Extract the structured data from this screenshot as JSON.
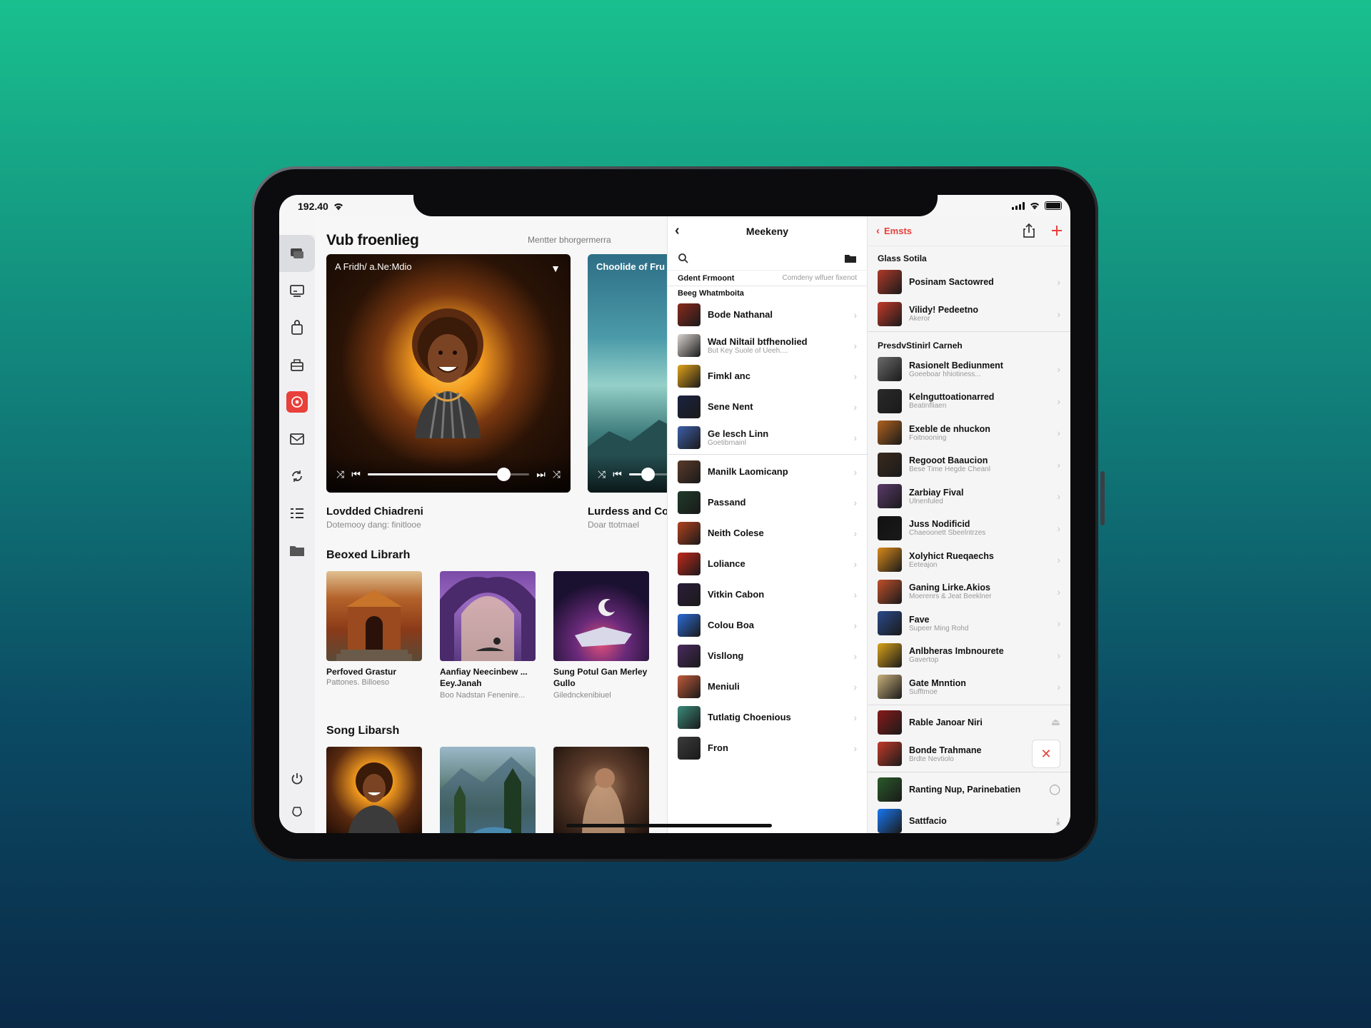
{
  "status": {
    "time": "192.40"
  },
  "main": {
    "title": "Vub froenlieg",
    "subtitle": "Mentter bhorgermerra",
    "player": {
      "header": "A Fridh/ a.Ne:Mdio"
    },
    "player2": {
      "header": "Choolide of Fru"
    },
    "card1": {
      "title": "Lovdded Chiadreni",
      "subtitle": "Dotemooy dang: finitlooe"
    },
    "card2": {
      "title": "Lurdess and Co",
      "subtitle": "Doar ttotmael"
    },
    "section1": {
      "title": "Beoxed Librarh",
      "tiles": [
        {
          "title": "Perfoved Grastur",
          "subtitle": "Pattones. Billoeso"
        },
        {
          "title": "Aanfiay Neecinbew ... Eey.Janah",
          "subtitle": "Boo Nadstan Fenenire..."
        },
        {
          "title": "Sung Potul Gan Merley Gullo",
          "subtitle": "Gilednckenibiuel"
        }
      ]
    },
    "section2": {
      "title": "Song Libarsh"
    }
  },
  "middle": {
    "title": "Meekeny",
    "col_left": "Gdent Frmoont",
    "col_right": "Comdeny wlfuer fixenot",
    "group": "Beeg Whatmboita",
    "items": [
      {
        "title": "Bode Nathanal",
        "subtitle": "",
        "color": "#8a2a1c"
      },
      {
        "title": "Wad Niltail btfhenolied",
        "subtitle": "But Key Suole of Ueeh....",
        "color": "#d9d3cf"
      },
      {
        "title": "Fimkl anc",
        "subtitle": "",
        "color": "#e0a21a"
      },
      {
        "title": "Sene Nent",
        "subtitle": "",
        "color": "#1a2340"
      },
      {
        "title": "Ge lesch Linn",
        "subtitle": "Goetibrnainl",
        "color": "#3d5ea8"
      },
      {
        "title": "Manilk Laomicanp",
        "subtitle": "",
        "color": "#5a3a2a"
      },
      {
        "title": "Passand",
        "subtitle": "",
        "color": "#1f3b2a"
      },
      {
        "title": "Neith Colese",
        "subtitle": "",
        "color": "#b2421e"
      },
      {
        "title": "Loliance",
        "subtitle": "",
        "color": "#c2281c"
      },
      {
        "title": "Vitkin Cabon",
        "subtitle": "",
        "color": "#2c1d3a"
      },
      {
        "title": "Colou Boa",
        "subtitle": "",
        "color": "#2c6bd6"
      },
      {
        "title": "Visllong",
        "subtitle": "",
        "color": "#4a2a5e"
      },
      {
        "title": "Meniuli",
        "subtitle": "",
        "color": "#c05a3a"
      },
      {
        "title": "Tutlatig Choenious",
        "subtitle": "",
        "color": "#3a8a7a"
      },
      {
        "title": "Fron",
        "subtitle": "",
        "color": "#3b3b3b"
      }
    ]
  },
  "right": {
    "back_label": "Emsts",
    "group1": "Glass Sotila",
    "group1_items": [
      {
        "title": "Posinam Sactowred",
        "subtitle": "",
        "color": "#b03a2a"
      },
      {
        "title": "Vilidy! Pedeetno",
        "subtitle": "Akeror",
        "color": "#c23a2a"
      }
    ],
    "group2": "PresdvStinirl Carneh",
    "group2_items": [
      {
        "title": "Rasionelt Bediunment",
        "subtitle": "Goeeboar hhiotiness...",
        "color": "#6a6a6a"
      },
      {
        "title": "Kelnguttoationarred",
        "subtitle": "Beatinfliaen",
        "color": "#2a2a2a"
      },
      {
        "title": "Exeble de nhuckon",
        "subtitle": "Foitnooning",
        "color": "#b0621e"
      },
      {
        "title": "Regooot Baaucion",
        "subtitle": "Bese Time Hegde Cheanl",
        "color": "#3a2a1e"
      },
      {
        "title": "Zarbiay Fival",
        "subtitle": "Ulnenfuled",
        "color": "#5a3a6a"
      },
      {
        "title": "Juss Nodificid",
        "subtitle": "Chaeoonett Sbeelntrzes",
        "color": "#111111"
      },
      {
        "title": "Xolyhict Rueqaechs",
        "subtitle": "Eeteajon",
        "color": "#d88a1a"
      },
      {
        "title": "Ganing Lirke.Akios",
        "subtitle": "Moerenrs & Jeat Beeklner",
        "color": "#c0502a"
      },
      {
        "title": "Fave",
        "subtitle": "Supeer Ming Rohd",
        "color": "#2a4a8a"
      },
      {
        "title": "Anlbheras Imbnourete",
        "subtitle": "Gavertop",
        "color": "#d8a21a"
      },
      {
        "title": "Gate Mnntion",
        "subtitle": "Sufftmoe",
        "color": "#c8b07a"
      }
    ],
    "group3_items": [
      {
        "title": "Rable Janoar Niri",
        "subtitle": "",
        "color": "#8a1a1a"
      },
      {
        "title": "Bonde Trahmane",
        "subtitle": "Brdte Nevtiolo",
        "color": "#c23a2a"
      }
    ],
    "group4_items": [
      {
        "title": "Ranting Nup, Parinebatien",
        "subtitle": "",
        "color": "#2a5a2a"
      },
      {
        "title": "Sattfacio",
        "subtitle": "",
        "color": "#1877f2"
      }
    ]
  }
}
